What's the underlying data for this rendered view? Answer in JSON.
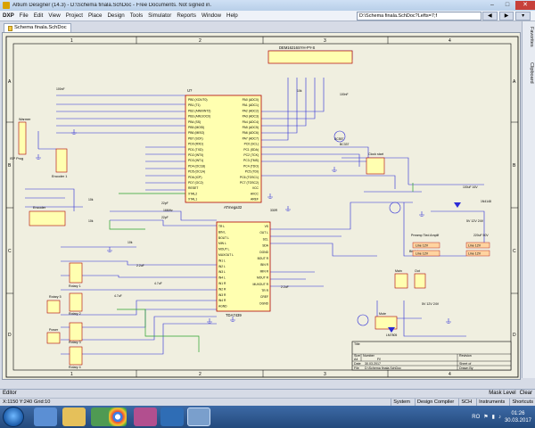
{
  "window": {
    "title": "Altium Designer (14.3) - D:\\Schema finala.SchDoc - Free Documents. Not signed in.",
    "controls": [
      "–",
      "□",
      "✕"
    ]
  },
  "menu": {
    "items": [
      "DXP",
      "File",
      "Edit",
      "View",
      "Project",
      "Place",
      "Design",
      "Tools",
      "Simulator",
      "Reports",
      "Window",
      "Help"
    ],
    "path": "D:\\Schema finala.SchDoc?Lefts=7;f"
  },
  "tabs": {
    "document": "Schema finala.SchDoc"
  },
  "right_panels": [
    "Favorites",
    "Clipboard"
  ],
  "schematic": {
    "border_numbers": [
      "1",
      "2",
      "3",
      "4"
    ],
    "border_letters": [
      "A",
      "B",
      "C",
      "D"
    ],
    "components": {
      "mcu": {
        "ref": "U?",
        "name": "ATmega32",
        "pins_left": [
          "PB0 (XCK/T0)",
          "PB1 (T1)",
          "PB2 (AIN0/INT2)",
          "PB3 (AIN1/OC0)",
          "PB4 (SS)",
          "PB5 (MOSI)",
          "PB6 (MISO)",
          "PB7 (SCK)",
          "PD0 (RXD)",
          "PD1 (TXD)",
          "PD2 (INT0)",
          "PD3 (INT1)",
          "PD4 (OC1B)",
          "PD5 (OC1A)",
          "PD6 (ICP)",
          "PD7 (OC2)",
          "RESET",
          "XTAL2",
          "XTAL1"
        ],
        "pins_right": [
          "PA0 (ADC0)",
          "PA1 (ADC1)",
          "PA2 (ADC2)",
          "PA3 (ADC3)",
          "PA4 (ADC4)",
          "PA5 (ADC5)",
          "PA6 (ADC6)",
          "PA7 (ADC7)",
          "PC0 (SCL)",
          "PC1 (SDA)",
          "PC2 (TCK)",
          "PC3 (TMS)",
          "PC4 (TDO)",
          "PC5 (TDI)",
          "PC6 (TOSC1)",
          "PC7 (TOSC2)",
          "VCC",
          "AVCC",
          "AREF"
        ]
      },
      "audio": {
        "ref": "U?",
        "name": "TDA7439",
        "pins_left": [
          "TR L",
          "BIN L",
          "BOUT L",
          "MIN L",
          "MOUT L",
          "MUXOUT L",
          "IN1 L",
          "IN2 L",
          "IN3 L",
          "IN4 L",
          "IN1 R",
          "IN2 R",
          "IN3 R",
          "IN4 R",
          "AGND"
        ],
        "pins_right": [
          "VS",
          "OUT L",
          "SCL",
          "SDA",
          "DGND",
          "BOUT R",
          "BIN R",
          "MIN R",
          "MOUT R",
          "MUXOUT R",
          "TR R",
          "CREF",
          "DGND"
        ]
      },
      "lcd": {
        "ref": "DEM",
        "name": "DEM16216SYH-PY-S",
        "pins": [
          "1",
          "2",
          "3",
          "4",
          "5",
          "6",
          "7",
          "8",
          "9",
          "10",
          "11",
          "12",
          "13",
          "14",
          "15",
          "16"
        ]
      },
      "labels": [
        "Warmer",
        "ISP Prog",
        "Encoder 1",
        "Encoder",
        "Rotary 1",
        "Rotary 2",
        "Rotary 3",
        "Rotary 4",
        "Rotary 5",
        "Power",
        "Main",
        "Out",
        "Bitslot",
        "Mute",
        "Clock start",
        "Preamp Tied Amplif"
      ],
      "power_labels": [
        "5V 12V 24V",
        "5V 12V 24V",
        "Line 12V",
        "Line 12V",
        "Line 12V",
        "Line 12V",
        "Line 12V"
      ],
      "values": [
        "100nF",
        "100nF",
        "10k",
        "10k",
        "10k",
        "BC557",
        "BC337",
        "2.2uF",
        "4.7uF",
        "4.7uF",
        "2.2uF",
        "22pF",
        "22pF",
        "16MHz",
        "220uF 50V",
        "100uF 16V",
        "1N4148",
        "10k",
        "330R",
        "LM7805"
      ]
    },
    "title_block": {
      "title_label": "Title",
      "size_label": "Size",
      "size_value": "A4",
      "number_label": "Number",
      "number_value": "Fi!",
      "revision_label": "Revision",
      "date_label": "Date",
      "date_value": "30.03.2017",
      "sheet_label": "Sheet of",
      "file_label": "File",
      "file_value": "D:\\Schema finala.SchDoc",
      "drawn_label": "Drawn By"
    }
  },
  "editor_bar": {
    "label": "Editor",
    "right": [
      "Mask Level",
      "Clear"
    ]
  },
  "status": {
    "coords": "X:1150 Y:240",
    "grid": "Grid:10",
    "panels": [
      "System",
      "Design Compiler",
      "SCH",
      "Instruments",
      "Shortcuts"
    ]
  },
  "taskbar": {
    "lang": "RO",
    "time": "01:26",
    "date": "30.03.2017"
  }
}
